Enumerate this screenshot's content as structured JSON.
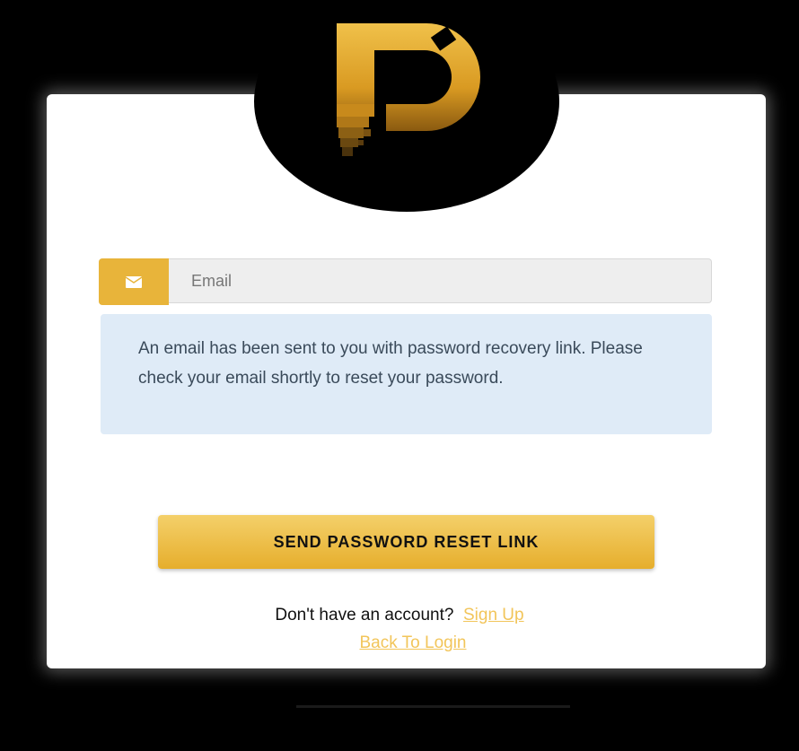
{
  "logo": {
    "icon": "p-logo-icon",
    "color": "#e3a82a"
  },
  "email": {
    "icon": "envelope-icon",
    "placeholder": "Email",
    "value": ""
  },
  "alert": {
    "message": "An email has been sent to you with password recovery link. Please check your email shortly to reset your password."
  },
  "actions": {
    "send_label": "SEND PASSWORD RESET LINK"
  },
  "footer": {
    "signup_prompt": "Don't have an account?",
    "signup_link": "Sign Up",
    "login_link": "Back To Login"
  },
  "colors": {
    "accent": "#e8b43a",
    "link": "#f2c55a",
    "alert_bg": "#dfebf7",
    "page_bg": "#000000"
  }
}
